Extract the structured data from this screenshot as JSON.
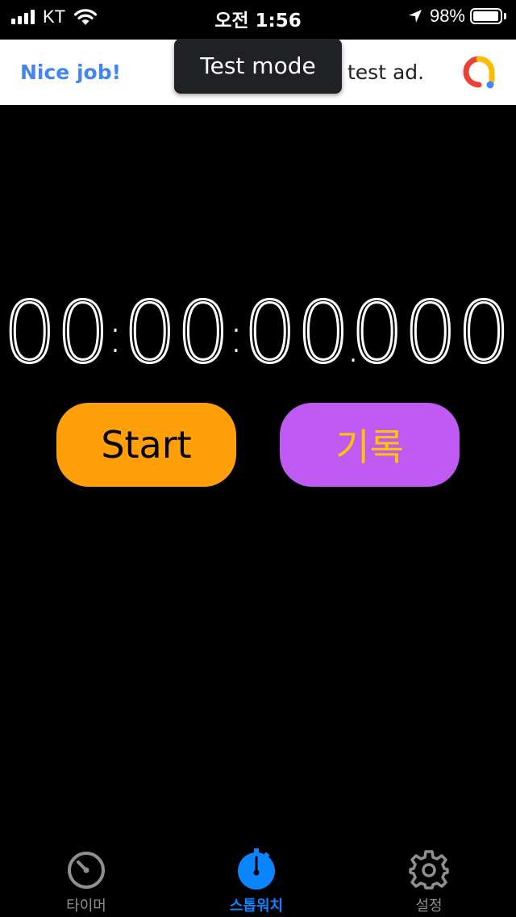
{
  "status_bar": {
    "carrier": "KT",
    "time": "오전 1:56",
    "battery_percent": "98%",
    "battery_level": 0.98,
    "icons": [
      "signal-bars-icon",
      "wifi-icon",
      "location-arrow-icon",
      "battery-icon"
    ]
  },
  "ad": {
    "left_text": "Nice job!",
    "right_text": "test ad.",
    "overlay_label": "Test mode",
    "logo_icon": "google-admob-icon"
  },
  "stopwatch": {
    "hours": "00",
    "minutes": "00",
    "seconds": "00",
    "milliseconds": "000",
    "sep1": ":",
    "sep2": ":",
    "sep3": "."
  },
  "buttons": {
    "start_label": "Start",
    "lap_label": "기록"
  },
  "tabs": [
    {
      "label": "타이머",
      "icon": "timer-icon",
      "active": false
    },
    {
      "label": "스톱워치",
      "icon": "stopwatch-icon",
      "active": true
    },
    {
      "label": "설정",
      "icon": "gear-icon",
      "active": false
    }
  ],
  "colors": {
    "background": "#000000",
    "start_button": "#ff9f0a",
    "lap_button": "#bf5af2",
    "lap_label": "#ffc400",
    "tab_active": "#0a84ff",
    "tab_inactive": "#8e8e93",
    "ad_link": "#4285f4"
  }
}
